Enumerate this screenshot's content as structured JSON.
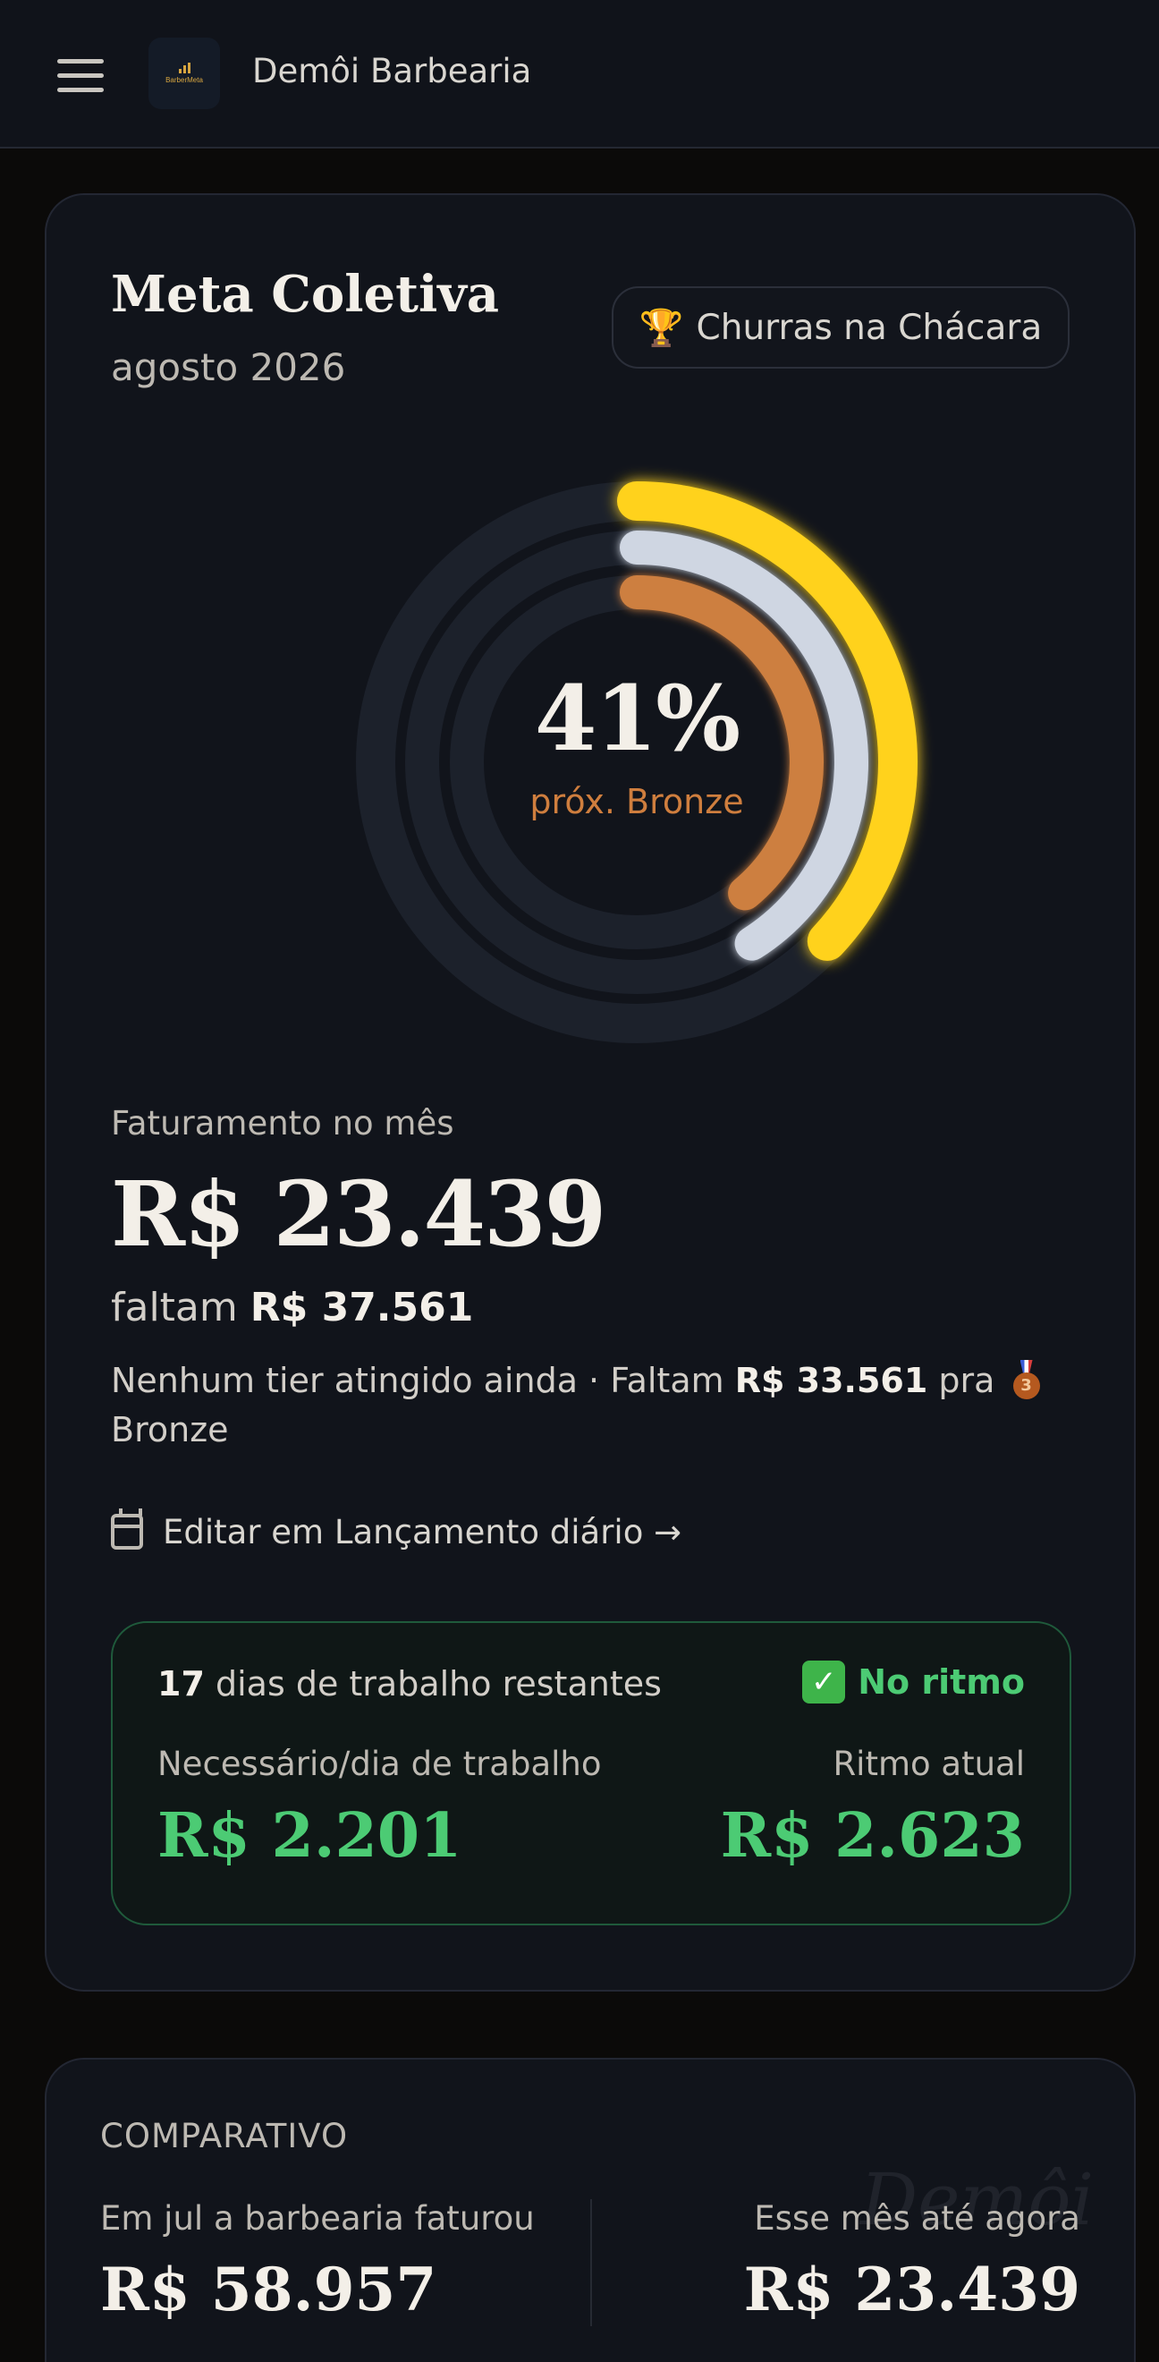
{
  "header": {
    "title": "Demôi Barbearia",
    "logo_text": "BarberMeta",
    "menu_icon": "hamburger-menu-icon"
  },
  "goal": {
    "title": "Meta Coletiva",
    "month": "agosto 2026",
    "reward_icon": "trophy-icon",
    "reward_label": "Churras na Chácara",
    "progress_percent_text": "41%",
    "next_tier_text": "próx. Bronze",
    "rings": [
      {
        "name": "Ouro",
        "color": "#ffd21f",
        "progress": 0.37
      },
      {
        "name": "Prata",
        "color": "#cfd6e2",
        "progress": 0.41
      },
      {
        "name": "Bronze",
        "color": "#cd7f3f",
        "progress": 0.39
      }
    ],
    "revenue_label": "Faturamento no mês",
    "revenue_value": "R$ 23.439",
    "remaining_prefix": "faltam",
    "remaining_value": "R$ 37.561",
    "tier_note_prefix": "Nenhum tier atingido ainda · Faltam",
    "tier_note_value": "R$ 33.561",
    "tier_note_mid": "pra",
    "tier_note_medal": "3",
    "tier_note_suffix": "Bronze",
    "edit_link": "Editar em Lançamento diário →"
  },
  "pace": {
    "days_number": "17",
    "days_text": "dias de trabalho restantes",
    "status_icon": "✓",
    "status_text": "No ritmo",
    "status_color": "#4ccb74",
    "needed_label": "Necessário/dia de trabalho",
    "needed_value": "R$ 2.201",
    "current_label": "Ritmo atual",
    "current_value": "R$ 2.623"
  },
  "comparison": {
    "title": "COMPARATIVO",
    "left_label": "Em jul a barbearia faturou",
    "left_value": "R$ 58.957",
    "right_label": "Esse mês até agora",
    "right_value": "R$ 23.439"
  }
}
